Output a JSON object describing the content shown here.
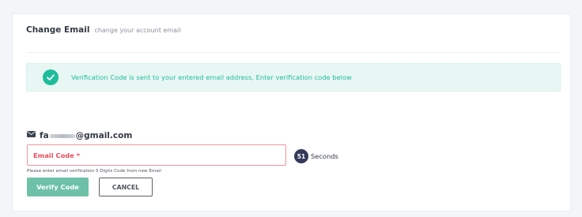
{
  "header": {
    "title": "Change Email",
    "subtitle": "change your account email"
  },
  "alert": {
    "icon": "check-circle-icon",
    "message": "Verification Code is sent to your entered email address, Enter verification code below",
    "color": "#1fbc9c"
  },
  "email": {
    "icon": "mail-icon",
    "prefix": "fa",
    "suffix": "@gmail.com"
  },
  "code_field": {
    "placeholder": "Email Code *",
    "value": "",
    "hint": "Please enter email verification 5 Digits Code from new Email",
    "border_color": "#f0959c"
  },
  "timer": {
    "value": "51",
    "label": "Seconds"
  },
  "buttons": {
    "verify_label": "Verify Code",
    "cancel_label": "CANCEL",
    "verify_color": "#6ec1a7"
  }
}
